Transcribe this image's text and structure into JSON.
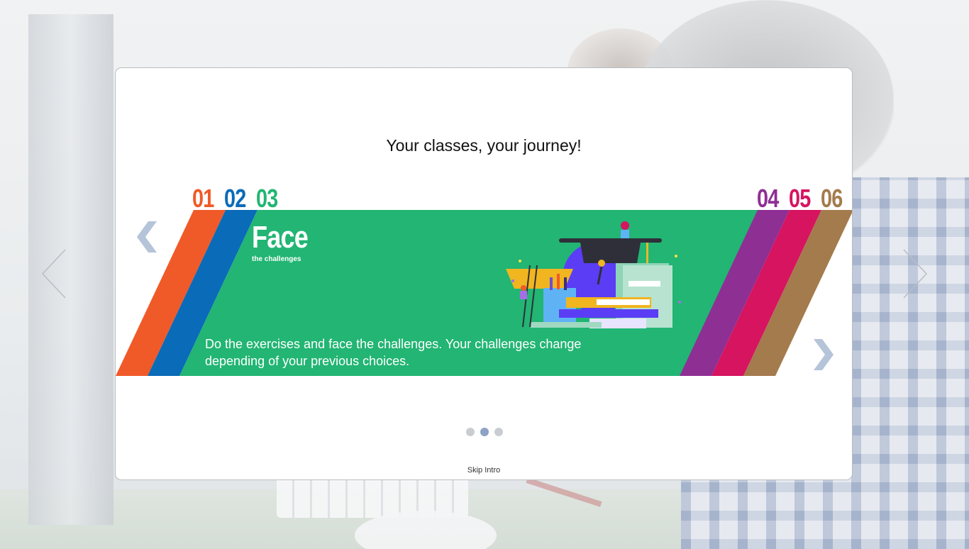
{
  "card": {
    "title": "Your classes, your journey!",
    "slide": {
      "heading": "Face",
      "subheading": "the challenges",
      "description": "Do the exercises and face the challenges. Your challenges change depending of your previous choices.",
      "step_numbers": [
        {
          "label": "01",
          "color": "#f05a28"
        },
        {
          "label": "02",
          "color": "#0a6bb8"
        },
        {
          "label": "03",
          "color": "#22b573"
        },
        {
          "label": "04",
          "color": "#8e2f94"
        },
        {
          "label": "05",
          "color": "#d6145f"
        },
        {
          "label": "06",
          "color": "#a47b4d"
        }
      ],
      "band_color": "#22b573"
    },
    "pagination": {
      "count": 3,
      "active_index": 1
    },
    "skip_label": "Skip Intro"
  },
  "icons": {
    "prev": "chevron-left-icon",
    "next": "chevron-right-icon",
    "outer_prev": "arrow-left-icon",
    "outer_next": "arrow-right-icon"
  },
  "colors": {
    "chevron": "#b5c4d8",
    "dot_active": "#8ea2c4",
    "dot_inactive": "#c9cdd1"
  }
}
